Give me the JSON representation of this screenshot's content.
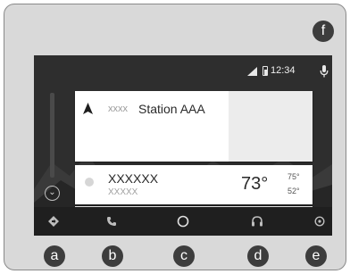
{
  "status_bar": {
    "time": "12:34",
    "icons": [
      "signal-icon",
      "battery-icon",
      "mic-icon"
    ]
  },
  "navigation_card": {
    "icon": "navigation-arrow-icon",
    "prefix": "xxxx",
    "destination": "Station AAA"
  },
  "weather_card": {
    "icon": "weather-dot-icon",
    "place": "XXXXXX",
    "subtitle": "XXXXX",
    "temperature": "73°",
    "high": "75°",
    "low": "52°"
  },
  "side_controls": {
    "expand_icon": "chevron-down-icon",
    "expand_glyph": "⌄"
  },
  "bottom_nav": {
    "items": [
      {
        "name": "navigation",
        "icon": "navigation-diamond-icon"
      },
      {
        "name": "phone",
        "icon": "phone-icon"
      },
      {
        "name": "home",
        "icon": "home-circle-icon"
      },
      {
        "name": "audio",
        "icon": "headphones-icon"
      },
      {
        "name": "exit",
        "icon": "power-icon"
      }
    ]
  },
  "callouts": {
    "a": "a",
    "b": "b",
    "c": "c",
    "d": "d",
    "e": "e",
    "f": "f"
  },
  "colors": {
    "device_body": "#d9d9d9",
    "screen_bg": "#2b2b2b",
    "navbar_bg": "#1f1f1f",
    "card_bg": "#ffffff",
    "callout_bg": "#3d3d3d"
  }
}
